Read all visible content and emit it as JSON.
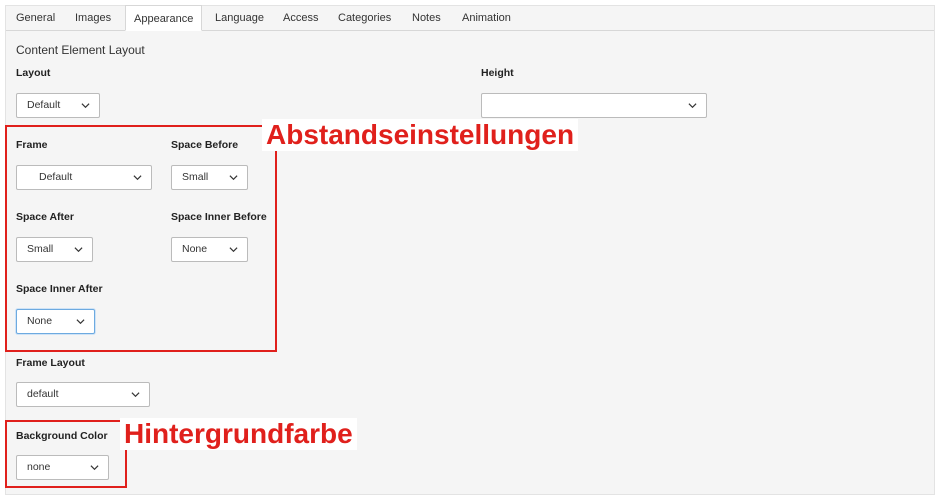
{
  "tabs": [
    {
      "label": "General"
    },
    {
      "label": "Images"
    },
    {
      "label": "Appearance"
    },
    {
      "label": "Language"
    },
    {
      "label": "Access"
    },
    {
      "label": "Categories"
    },
    {
      "label": "Notes"
    },
    {
      "label": "Animation"
    }
  ],
  "active_tab": "Appearance",
  "section": {
    "title": "Content Element Layout"
  },
  "fields": {
    "layout": {
      "label": "Layout",
      "value": "Default"
    },
    "height": {
      "label": "Height",
      "value": ""
    },
    "frame": {
      "label": "Frame",
      "value": "Default"
    },
    "space_before": {
      "label": "Space Before",
      "value": "Small"
    },
    "space_after": {
      "label": "Space After",
      "value": "Small"
    },
    "space_inner_before": {
      "label": "Space Inner Before",
      "value": "None"
    },
    "space_inner_after": {
      "label": "Space Inner After",
      "value": "None"
    },
    "frame_layout": {
      "label": "Frame Layout",
      "value": "default"
    },
    "background_color": {
      "label": "Background Color",
      "value": "none"
    }
  },
  "annotations": {
    "spacing": "Abstandseinstellungen",
    "background": "Hintergrundfarbe"
  },
  "colors": {
    "annotation_red": "#e0201c",
    "focus_border": "#6daae0"
  }
}
